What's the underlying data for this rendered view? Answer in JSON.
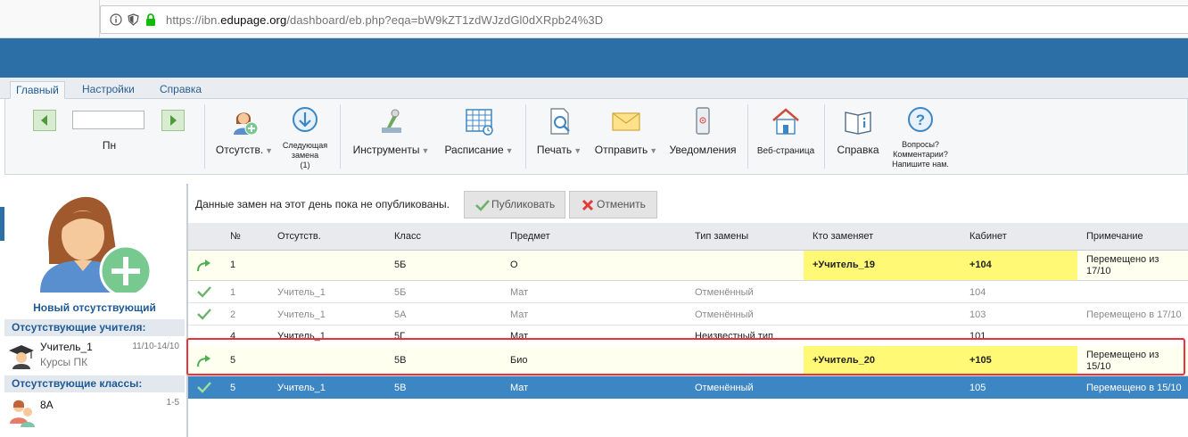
{
  "browser": {
    "url_prefix": "https://ibn.",
    "url_domain": "edupage.org",
    "url_path": "/dashboard/eb.php?eqa=bW9kZT1zdWJzdGl0dXRpb24%3D"
  },
  "tabs": [
    {
      "label": "Главный",
      "active": true
    },
    {
      "label": "Настройки"
    },
    {
      "label": "Справка"
    }
  ],
  "ribbon": {
    "day_label": "Пн",
    "absences_label": "Отсутств.",
    "next_sub_line1": "Следующая",
    "next_sub_line2": "замена",
    "next_sub_count": "(1)",
    "tools_label": "Инструменты",
    "timetable_label": "Расписание",
    "print_label": "Печать",
    "send_label": "Отправить",
    "notifications_label": "Уведомления",
    "webpage_label": "Веб-страница",
    "help_label": "Справка",
    "questions_line1": "Вопросы?",
    "questions_line2": "Комментарии?",
    "questions_line3": "Напишите нам."
  },
  "left_panel": {
    "new_absent_label": "Новый отсутствующий",
    "absent_teachers_header": "Отсутствующие учителя:",
    "teacher": {
      "name": "Учитель_1",
      "sub": "Курсы ПК",
      "range": "11/10-14/10"
    },
    "absent_classes_header": "Отсутствующие классы:",
    "class_item": {
      "name": "8А",
      "range": "1-5"
    }
  },
  "main": {
    "notice": "Данные замен на этот день пока не опубликованы.",
    "publish_label": "Публиковать",
    "cancel_label": "Отменить"
  },
  "table": {
    "columns": [
      "№",
      "Отсутств.",
      "Класс",
      "Предмет",
      "Тип замены",
      "Кто заменяет",
      "Кабинет",
      "Примечание"
    ],
    "rows": [
      {
        "no": "1",
        "absent": "",
        "class": "5Б",
        "subject": "О",
        "type": "",
        "who": "+Учитель_19",
        "room": "+104",
        "note1": "Перемещено из",
        "note2": "17/10"
      },
      {
        "no": "1",
        "absent": "Учитель_1",
        "class": "5Б",
        "subject": "Мат",
        "type": "Отменённый",
        "who": "",
        "room": "104",
        "note1": "",
        "note2": ""
      },
      {
        "no": "2",
        "absent": "Учитель_1",
        "class": "5А",
        "subject": "Мат",
        "type": "Отменённый",
        "who": "",
        "room": "103",
        "note1": "Перемещено в 17/10",
        "note2": ""
      },
      {
        "no": "4",
        "absent": "Учитель_1",
        "class": "5Г",
        "subject": "Мат",
        "type": "Неизвестный тип",
        "who": "",
        "room": "101",
        "note1": "",
        "note2": ""
      },
      {
        "no": "5",
        "absent": "",
        "class": "5В",
        "subject": "Био",
        "type": "",
        "who": "+Учитель_20",
        "room": "+105",
        "note1": "Перемещено из",
        "note2": "15/10"
      },
      {
        "no": "5",
        "absent": "Учитель_1",
        "class": "5В",
        "subject": "Мат",
        "type": "Отменённый",
        "who": "",
        "room": "105",
        "note1": "Перемещено в 15/10",
        "note2": ""
      }
    ]
  },
  "colors": {
    "header_blue": "#2c6ea6",
    "highlight_yellow": "#fff976",
    "selected_row": "#3d86c4",
    "annotation_red": "#e8323c"
  }
}
